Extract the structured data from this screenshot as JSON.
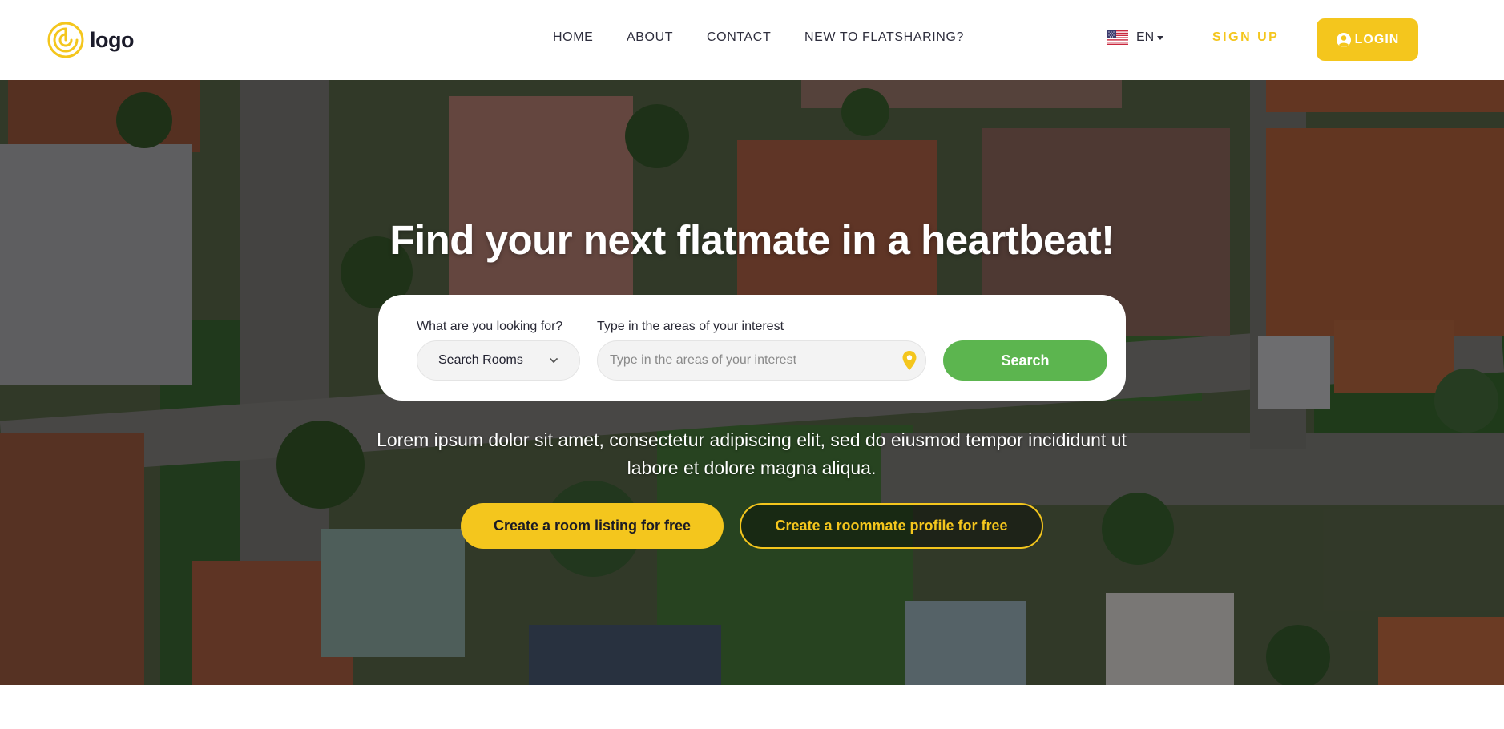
{
  "brand": {
    "logo_text": "logo",
    "accent_color": "#f4c61d",
    "success_color": "#5cb54f"
  },
  "nav": {
    "items": [
      {
        "label": "HOME"
      },
      {
        "label": "ABOUT"
      },
      {
        "label": "CONTACT"
      },
      {
        "label": "NEW TO FLATSHARING?"
      }
    ]
  },
  "language": {
    "code": "EN",
    "flag_icon": "us-flag-icon"
  },
  "auth": {
    "signup_label": "SIGN UP",
    "login_label": "LOGIN",
    "login_icon": "user-circle-icon"
  },
  "hero": {
    "title": "Find your next flatmate in a heartbeat!",
    "subtitle": "Lorem ipsum dolor sit amet, consectetur adipiscing elit, sed do eiusmod tempor incididunt ut labore et dolore magna aliqua.",
    "primary_cta": "Create a room listing for free",
    "secondary_cta": "Create a roommate profile for free"
  },
  "search": {
    "type_label": "What are you looking for?",
    "type_value": "Search Rooms",
    "area_label": "Type in the areas of your interest",
    "area_placeholder": "Type in the areas of your interest",
    "area_value": "",
    "location_icon": "location-pin-icon",
    "button_label": "Search"
  }
}
